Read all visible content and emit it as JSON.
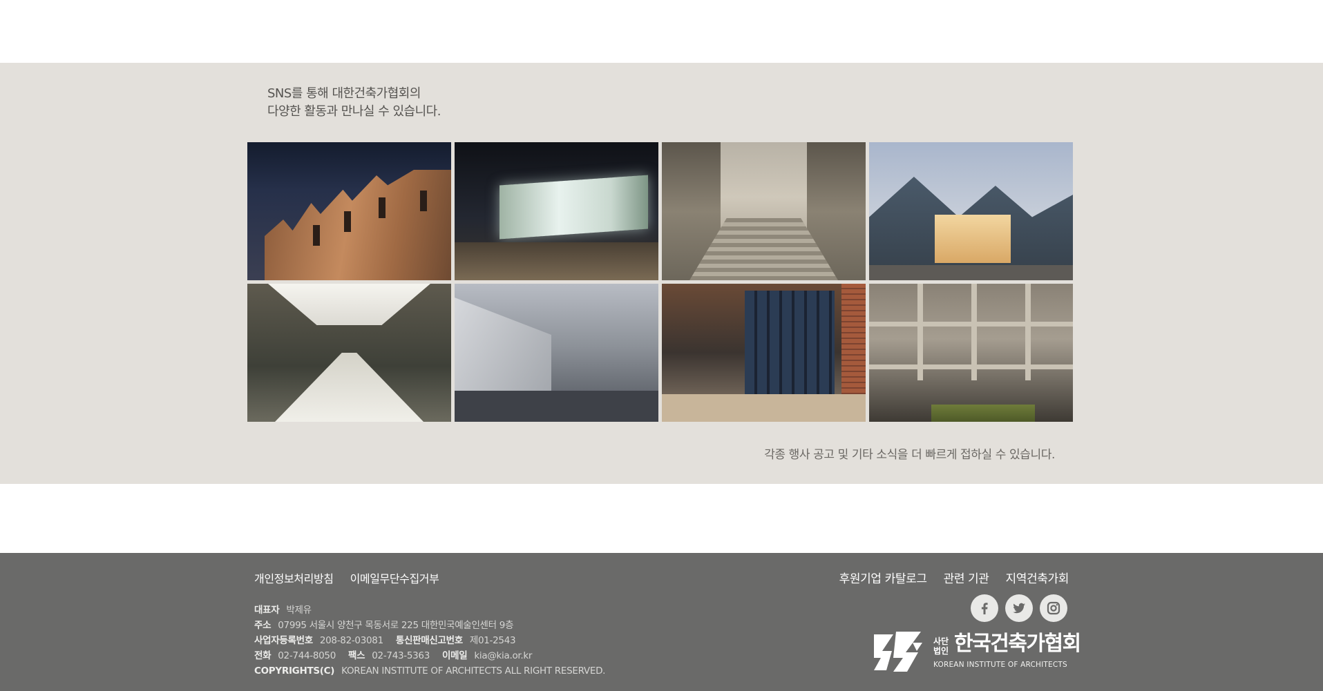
{
  "sns": {
    "intro_line1": "SNS를 통해 대한건축가협회의",
    "intro_line2": "다양한 활동과 만나실 수 있습니다.",
    "note": "각종 행사 공고 및 기타 소식을 더 빠르게 접하실 수 있습니다."
  },
  "footer": {
    "links_left": [
      "개인정보처리방침",
      "이메일무단수집거부"
    ],
    "links_right": [
      "후원기업 카탈로그",
      "관련 기관",
      "지역건축가회"
    ],
    "info": {
      "rep_label": "대표자",
      "rep_value": "박제유",
      "addr_label": "주소",
      "addr_value": "07995 서울시 양천구 목동서로 225 대한민국예술인센터 9층",
      "bizno_label": "사업자등록번호",
      "bizno_value": "208-82-03081",
      "mailorder_label": "통신판매신고번호",
      "mailorder_value": "제01-2543",
      "tel_label": "전화",
      "tel_value": "02-744-8050",
      "fax_label": "팩스",
      "fax_value": "02-743-5363",
      "email_label": "이메일",
      "email_value": "kia@kia.or.kr",
      "copyright_label": "COPYRIGHTS(C)",
      "copyright_value": "KOREAN INSTITUTE OF ARCHITECTS ALL RIGHT RESERVED."
    },
    "social": [
      "facebook-icon",
      "twitter-icon",
      "instagram-icon"
    ],
    "logo": {
      "small_line1": "사단",
      "small_line2": "법인",
      "name_ko": "한국건축가협회",
      "name_en": "KOREAN INSTITUTE OF ARCHITECTS"
    }
  }
}
